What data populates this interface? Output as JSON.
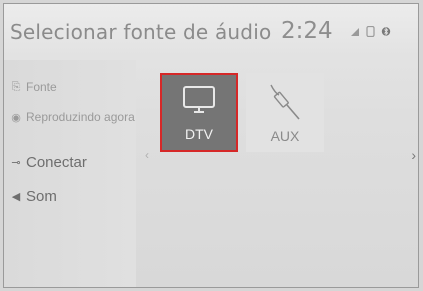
{
  "header": {
    "title": "Selecionar fonte de áudio",
    "clock": "2:24",
    "status_icons": [
      "signal-icon",
      "phone-icon",
      "bluetooth-icon"
    ]
  },
  "sidebar": {
    "items": [
      {
        "label": "Fonte",
        "icon": "source-icon"
      },
      {
        "label": "Reproduzindo agora",
        "icon": "now-playing-icon"
      },
      {
        "label": "Conectar",
        "icon": "connect-icon"
      },
      {
        "label": "Som",
        "icon": "speaker-icon"
      }
    ]
  },
  "sources": [
    {
      "label": "DTV",
      "icon": "tv-icon",
      "selected": true
    },
    {
      "label": "AUX",
      "icon": "aux-cable-icon",
      "selected": false
    }
  ],
  "colors": {
    "selected_tile": "#757575",
    "selection_border": "#d62828",
    "background": "#dedede"
  }
}
